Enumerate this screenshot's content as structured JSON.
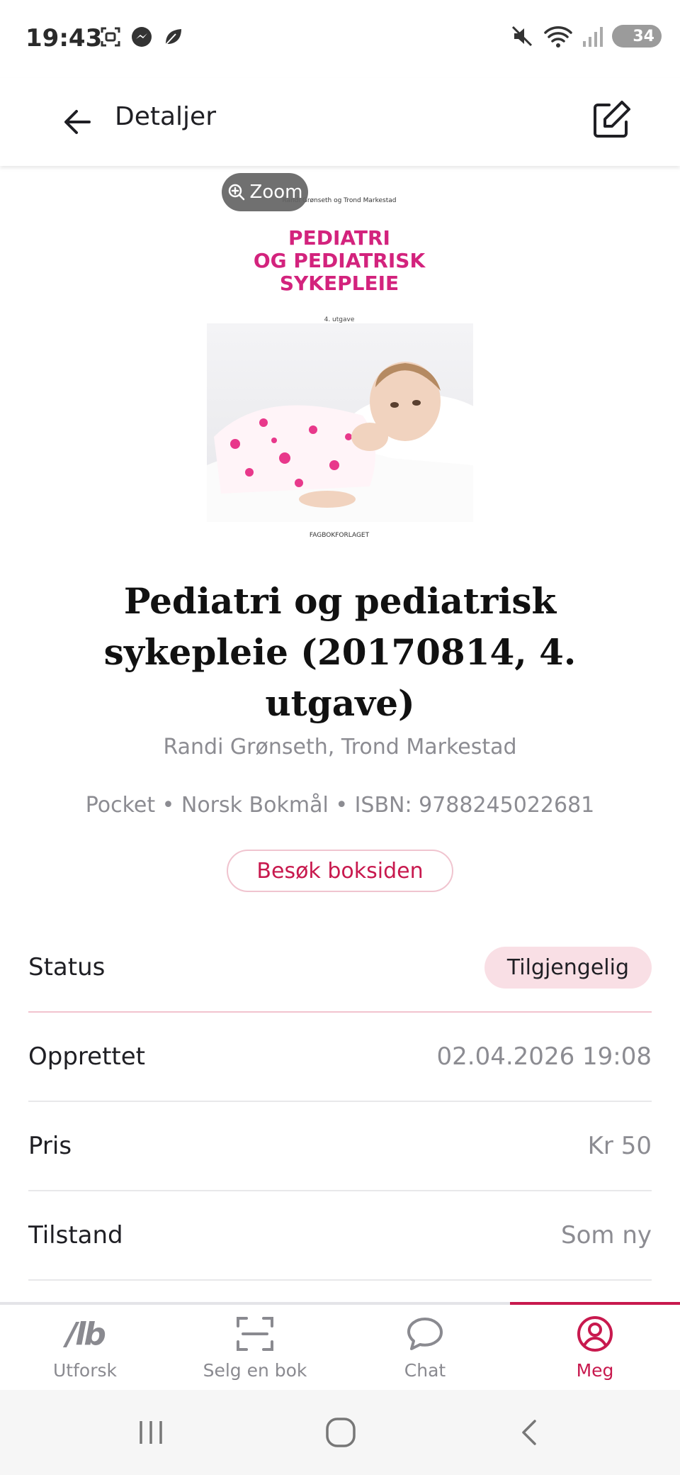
{
  "status_bar": {
    "time": "19:43",
    "left_icons": [
      "screenshot-icon",
      "messenger-icon",
      "leaf-icon"
    ],
    "right_icons": [
      "mute-icon",
      "wifi-icon",
      "signal-icon"
    ],
    "battery": "34"
  },
  "app_bar": {
    "title": "Detaljer",
    "back_icon": "arrow-left-icon",
    "edit_icon": "edit-icon"
  },
  "cover": {
    "zoom_label": "Zoom",
    "authors": "Randi Grønseth og Trond Markestad",
    "title_lines": [
      "PEDIATRI",
      "OG PEDIATRISK",
      "SYKEPLEIE"
    ],
    "edition": "4. utgave",
    "publisher": "FAGBOKFORLAGET"
  },
  "book": {
    "title": "Pediatri og pediatrisk sykepleie (20170814, 4. utgave)",
    "authors": "Randi Grønseth, Trond Markestad",
    "meta": "Pocket • Norsk Bokmål • ISBN: 9788245022681",
    "visit_button": "Besøk boksiden"
  },
  "details": {
    "status": {
      "label": "Status",
      "value": "Tilgjengelig"
    },
    "created": {
      "label": "Opprettet",
      "value": "02.04.2026 19:08"
    },
    "price": {
      "label": "Pris",
      "value": "Kr 50"
    },
    "condition": {
      "label": "Tilstand",
      "value": "Som ny"
    }
  },
  "bottom_nav": {
    "items": [
      {
        "label": "Utforsk",
        "icon": "lb-logo-icon"
      },
      {
        "label": "Selg en bok",
        "icon": "scan-icon"
      },
      {
        "label": "Chat",
        "icon": "chat-bubble-icon"
      },
      {
        "label": "Meg",
        "icon": "profile-icon"
      }
    ],
    "active_index": 3
  },
  "colors": {
    "accent": "#c8194e",
    "cover_title": "#d3237d",
    "status_pill_bg": "#f9dfe5",
    "muted_text": "#8c8c92"
  }
}
